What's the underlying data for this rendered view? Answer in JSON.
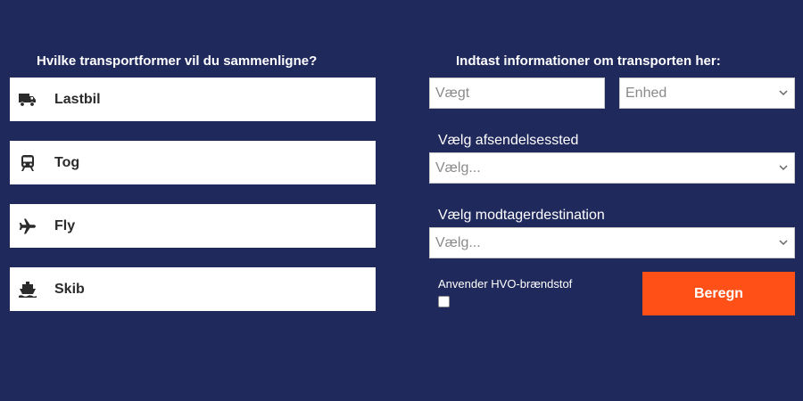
{
  "left": {
    "heading": "Hvilke transportformer vil du sammenligne?",
    "modes": [
      {
        "label": "Lastbil",
        "icon": "truck-icon"
      },
      {
        "label": "Tog",
        "icon": "train-icon"
      },
      {
        "label": "Fly",
        "icon": "airplane-icon"
      },
      {
        "label": "Skib",
        "icon": "ship-icon"
      }
    ]
  },
  "right": {
    "heading": "Indtast informationer om transporten her:",
    "weight_placeholder": "Vægt",
    "unit_select": "Enhed",
    "origin_label": "Vælg afsendelsessted",
    "origin_select": "Vælg...",
    "destination_label": "Vælg modtagerdestination",
    "destination_select": "Vælg...",
    "hvo_label": "Anvender HVO-brændstof",
    "hvo_checked": false,
    "calculate_button": "Beregn"
  },
  "colors": {
    "background": "#20295c",
    "accent": "#ff5018"
  }
}
